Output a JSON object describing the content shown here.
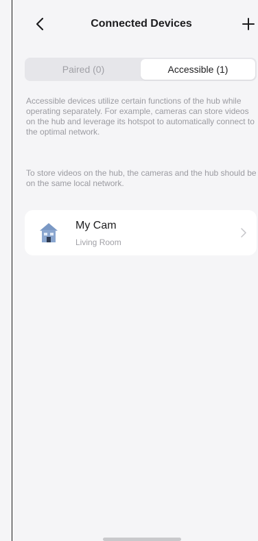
{
  "header": {
    "title": "Connected Devices"
  },
  "tabs": [
    {
      "label": "Paired (0)",
      "active": false
    },
    {
      "label": "Accessible (1)",
      "active": true
    }
  ],
  "description": {
    "paragraph1": "Accessible devices utilize certain functions of the hub while operating separately. For example, cameras can store videos on the hub and leverage its hotspot to automatically connect to the optimal network.",
    "paragraph2": "To store videos on the hub, the cameras and the hub should be on the same local network."
  },
  "devices": [
    {
      "name": "My Cam",
      "room": "Living Room",
      "icon": "house-icon"
    }
  ],
  "colors": {
    "background": "#f5f5f7",
    "card": "#ffffff",
    "segment_bg": "#e6e6ea",
    "muted_text": "#9a9aa0",
    "house_icon": "#7a98c4"
  }
}
